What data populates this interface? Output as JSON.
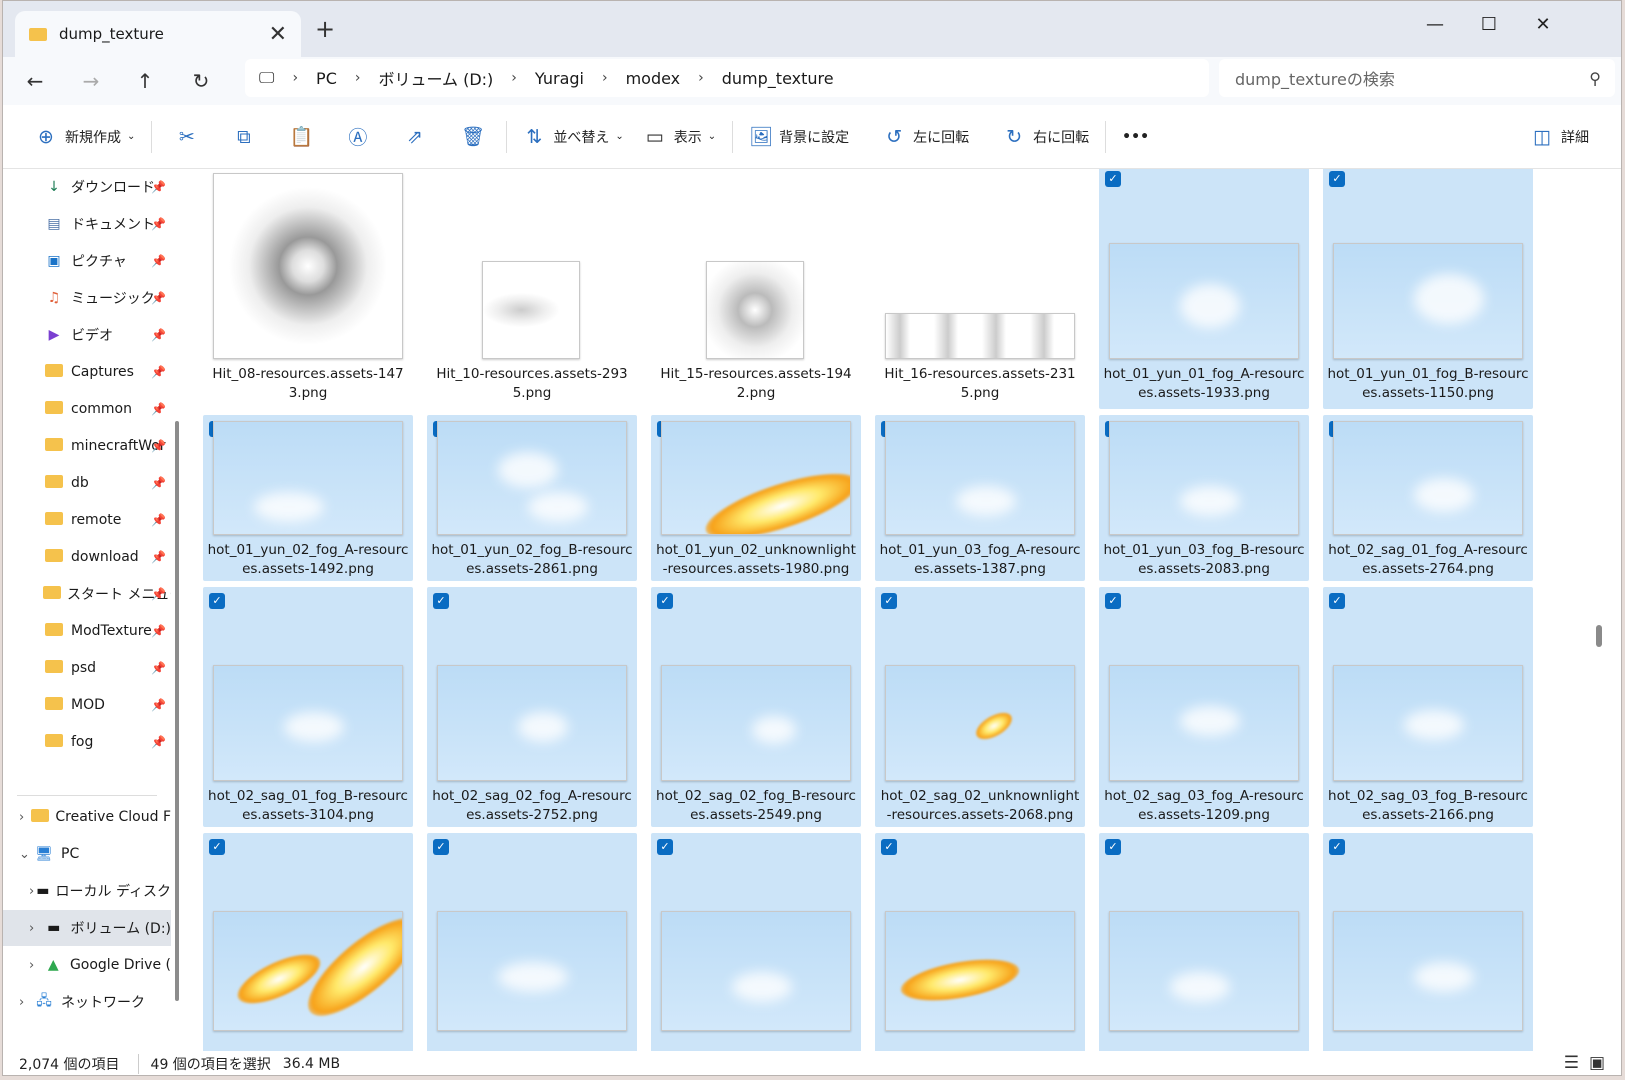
{
  "window": {
    "tab_title": "dump_texture",
    "close_tab": "✕",
    "new_tab": "+",
    "minimize": "—",
    "maximize": "☐",
    "close": "✕"
  },
  "nav": {
    "back": "←",
    "forward": "→",
    "up": "↑",
    "refresh": "↻",
    "breadcrumb": [
      "PC",
      "ボリューム (D:)",
      "Yuragi",
      "modex",
      "dump_texture"
    ],
    "search_placeholder": "dump_textureの検索"
  },
  "toolbar": {
    "new": "新規作成",
    "sort": "並べ替え",
    "view": "表示",
    "set_background": "背景に設定",
    "rotate_left": "左に回転",
    "rotate_right": "右に回転",
    "more": "•••",
    "details": "詳細"
  },
  "sidebar": {
    "pinned": [
      "ダウンロード",
      "ドキュメント",
      "ピクチャ",
      "ミュージック",
      "ビデオ",
      "Captures",
      "common",
      "minecraftWor",
      "db",
      "remote",
      "download",
      "スタート メニュー",
      "ModTexture",
      "psd",
      "MOD",
      "fog"
    ],
    "tree": [
      "Creative Cloud F",
      "PC",
      "ローカル ディスク",
      "ボリューム (D:)",
      "Google Drive (",
      "ネットワーク"
    ]
  },
  "files": [
    {
      "name": "Hit_08-resources.assets-1473.png",
      "selected": false
    },
    {
      "name": "Hit_10-resources.assets-2935.png",
      "selected": false
    },
    {
      "name": "Hit_15-resources.assets-1942.png",
      "selected": false
    },
    {
      "name": "Hit_16-resources.assets-2315.png",
      "selected": false
    },
    {
      "name": "hot_01_yun_01_fog_A-resources.assets-1933.png",
      "selected": true
    },
    {
      "name": "hot_01_yun_01_fog_B-resources.assets-1150.png",
      "selected": true
    },
    {
      "name": "hot_01_yun_02_fog_A-resources.assets-1492.png",
      "selected": true
    },
    {
      "name": "hot_01_yun_02_fog_B-resources.assets-2861.png",
      "selected": true
    },
    {
      "name": "hot_01_yun_02_unknownlight-resources.assets-1980.png",
      "selected": true
    },
    {
      "name": "hot_01_yun_03_fog_A-resources.assets-1387.png",
      "selected": true
    },
    {
      "name": "hot_01_yun_03_fog_B-resources.assets-2083.png",
      "selected": true
    },
    {
      "name": "hot_02_sag_01_fog_A-resources.assets-2764.png",
      "selected": true
    },
    {
      "name": "hot_02_sag_01_fog_B-resources.assets-3104.png",
      "selected": true
    },
    {
      "name": "hot_02_sag_02_fog_A-resources.assets-2752.png",
      "selected": true
    },
    {
      "name": "hot_02_sag_02_fog_B-resources.assets-2549.png",
      "selected": true
    },
    {
      "name": "hot_02_sag_02_unknownlight-resources.assets-2068.png",
      "selected": true
    },
    {
      "name": "hot_02_sag_03_fog_A-resources.assets-1209.png",
      "selected": true
    },
    {
      "name": "hot_02_sag_03_fog_B-resources.assets-2166.png",
      "selected": true
    }
  ],
  "status": {
    "count": "2,074 個の項目",
    "selected": "49 個の項目を選択",
    "size": "36.4 MB"
  },
  "colors": {
    "selection": "#cce4f8",
    "checkbox": "#0a6cc2",
    "folder": "#f5c24c"
  }
}
